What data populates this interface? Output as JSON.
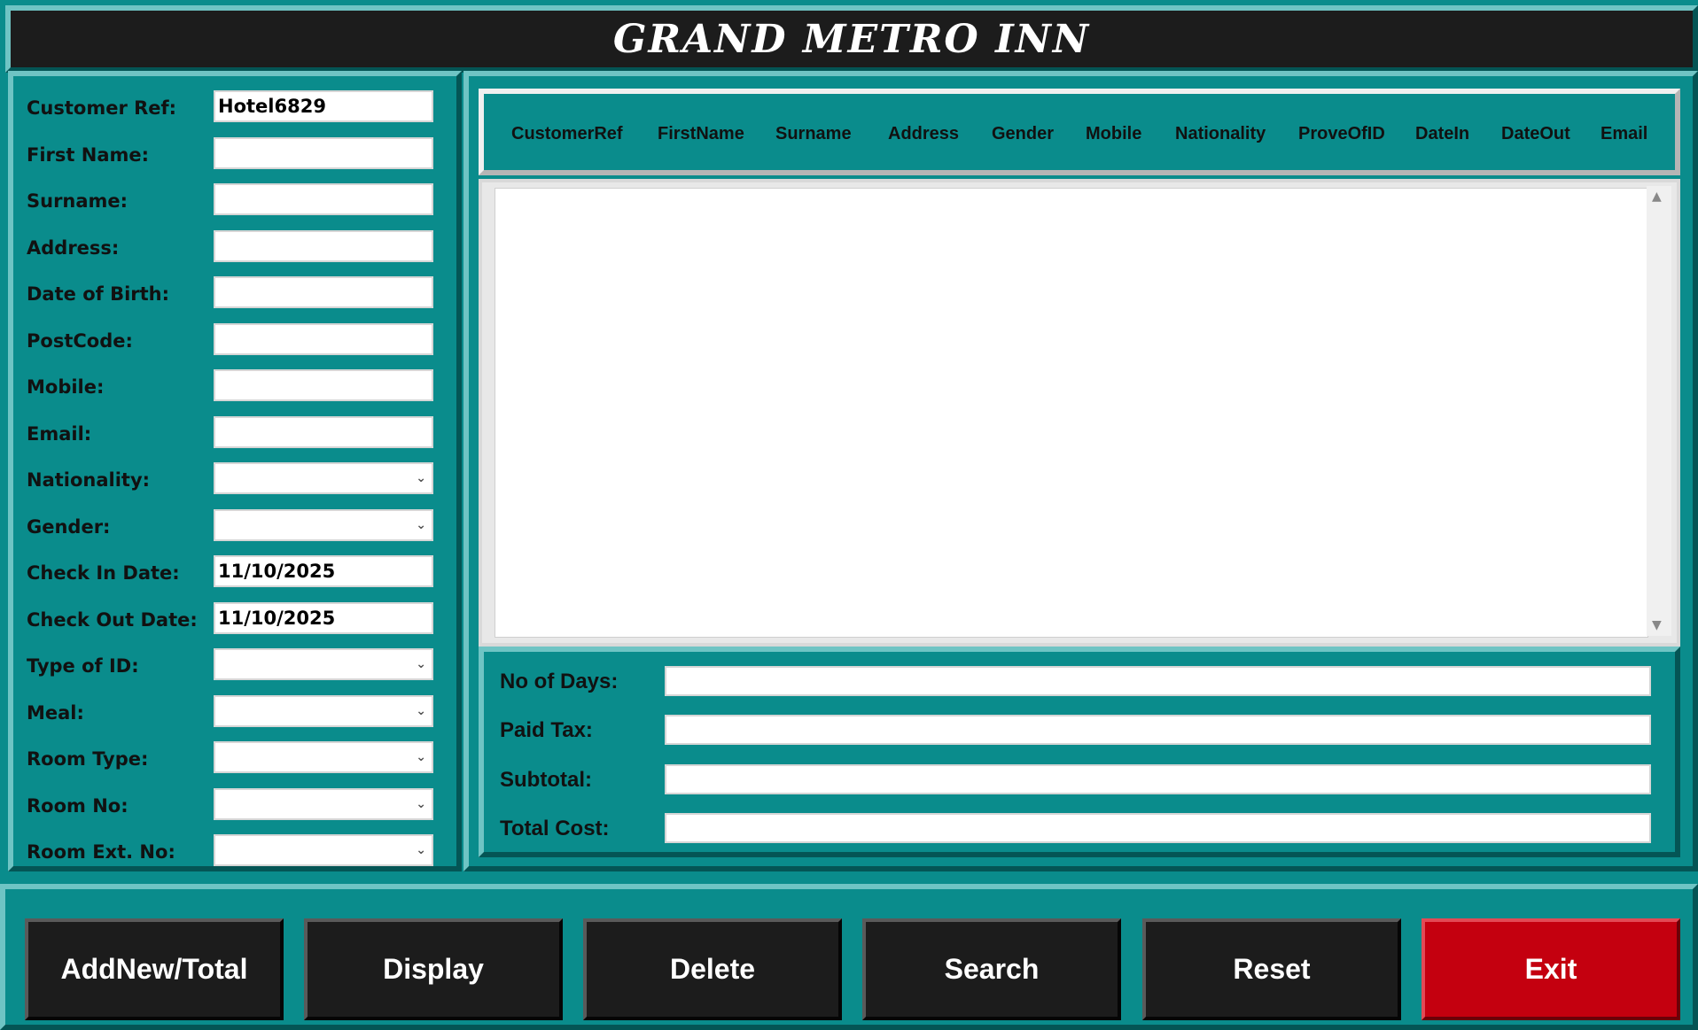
{
  "app": {
    "title": "GRAND METRO INN"
  },
  "form": {
    "customer_ref": {
      "label": "Customer Ref:",
      "value": "Hotel6829"
    },
    "first_name": {
      "label": "First Name:",
      "value": ""
    },
    "surname": {
      "label": "Surname:",
      "value": ""
    },
    "address": {
      "label": "Address:",
      "value": ""
    },
    "date_of_birth": {
      "label": "Date of Birth:",
      "value": ""
    },
    "postcode": {
      "label": "PostCode:",
      "value": ""
    },
    "mobile": {
      "label": "Mobile:",
      "value": ""
    },
    "email": {
      "label": "Email:",
      "value": ""
    },
    "nationality": {
      "label": "Nationality:",
      "value": ""
    },
    "gender": {
      "label": "Gender:",
      "value": ""
    },
    "check_in_date": {
      "label": "Check In Date:",
      "value": "11/10/2025"
    },
    "check_out_date": {
      "label": "Check Out Date:",
      "value": "11/10/2025"
    },
    "type_of_id": {
      "label": "Type of ID:",
      "value": ""
    },
    "meal": {
      "label": "Meal:",
      "value": ""
    },
    "room_type": {
      "label": "Room Type:",
      "value": ""
    },
    "room_no": {
      "label": "Room No:",
      "value": ""
    },
    "room_ext_no": {
      "label": "Room Ext. No:",
      "value": ""
    }
  },
  "table": {
    "headers": [
      "CustomerRef",
      "FirstName",
      "Surname",
      "Address",
      "Gender",
      "Mobile",
      "Nationality",
      "ProveOfID",
      "DateIn",
      "DateOut",
      "Email"
    ],
    "rows": []
  },
  "totals": {
    "no_of_days": {
      "label": "No of Days:",
      "value": ""
    },
    "paid_tax": {
      "label": "Paid Tax:",
      "value": ""
    },
    "subtotal": {
      "label": "Subtotal:",
      "value": ""
    },
    "total_cost": {
      "label": "Total Cost:",
      "value": ""
    }
  },
  "buttons": {
    "add_new": "AddNew/Total",
    "display": "Display",
    "delete": "Delete",
    "search": "Search",
    "reset": "Reset",
    "exit": "Exit"
  },
  "icons": {
    "dropdown": "chevron-down-icon",
    "scroll_up": "triangle-up-icon",
    "scroll_down": "triangle-down-icon"
  },
  "colors": {
    "background": "#0a8c8c",
    "title_bar": "#1c1c1c",
    "button": "#1c1c1c",
    "exit_button": "#c4000f",
    "text": "#ffffff"
  }
}
